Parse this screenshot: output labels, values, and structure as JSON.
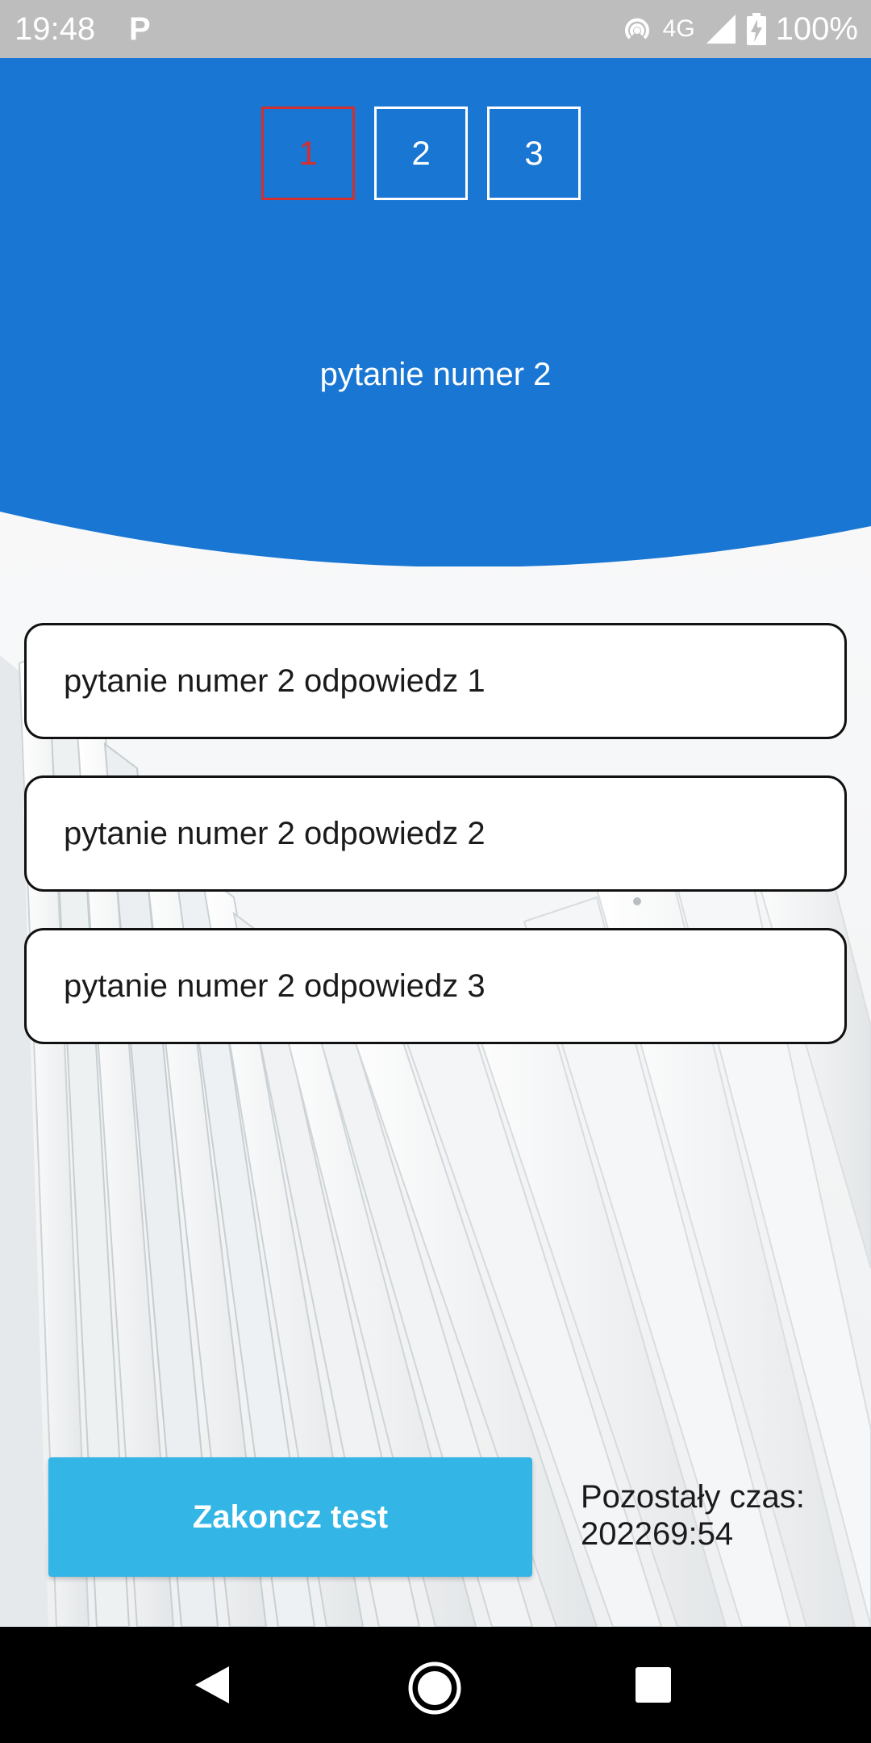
{
  "status_bar": {
    "time": "19:48",
    "app_icon": "P",
    "network": "4G",
    "battery": "100%",
    "icons": [
      "hotspot-icon",
      "signal-icon",
      "battery-charging-icon"
    ]
  },
  "colors": {
    "header_blue": "#1976d2",
    "active_question": "#d32f2f",
    "button_blue": "#33b5e5"
  },
  "question_nav": [
    {
      "label": "1",
      "active": true
    },
    {
      "label": "2",
      "active": false
    },
    {
      "label": "3",
      "active": false
    }
  ],
  "question": {
    "text": "pytanie numer 2"
  },
  "answers": [
    {
      "label": "pytanie numer 2 odpowiedz 1"
    },
    {
      "label": "pytanie numer 2 odpowiedz 2"
    },
    {
      "label": "pytanie numer 2 odpowiedz 3"
    }
  ],
  "footer": {
    "end_button_label": "Zakoncz test",
    "timer_label": "Pozostały czas:",
    "timer_value": "202269:54"
  },
  "nav_bar": {
    "icons": [
      "back-icon",
      "home-icon",
      "recents-icon"
    ]
  }
}
